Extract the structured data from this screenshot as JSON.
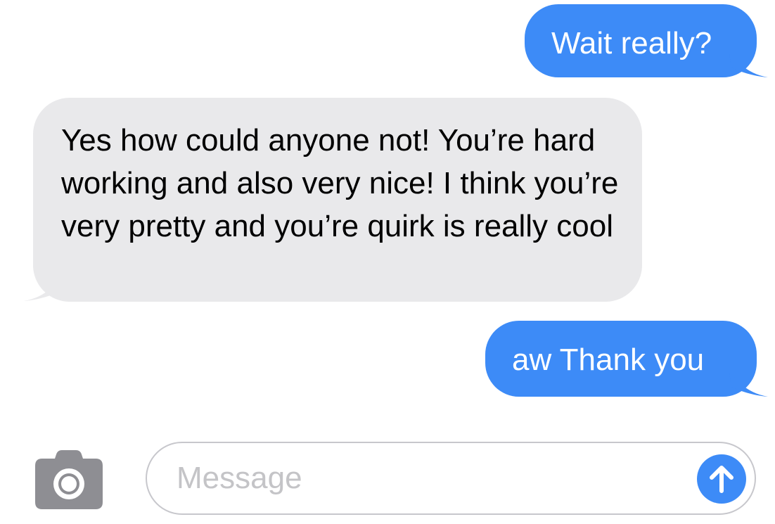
{
  "conversation": {
    "messages": [
      {
        "direction": "outgoing",
        "text": "Wait really?"
      },
      {
        "direction": "incoming",
        "text": "Yes how could anyone not! You’re hard working and also very nice! I think you’re very pretty and you’re quirk is really cool"
      },
      {
        "direction": "outgoing",
        "text": "aw Thank you"
      }
    ]
  },
  "composer": {
    "placeholder": "Message",
    "camera_icon": "camera-icon",
    "send_icon": "arrow-up-icon"
  },
  "colors": {
    "outgoing_bubble": "#3d8bf7",
    "incoming_bubble": "#e9e9eb",
    "send_button": "#3d8bf7",
    "camera_icon": "#8e8e93"
  }
}
